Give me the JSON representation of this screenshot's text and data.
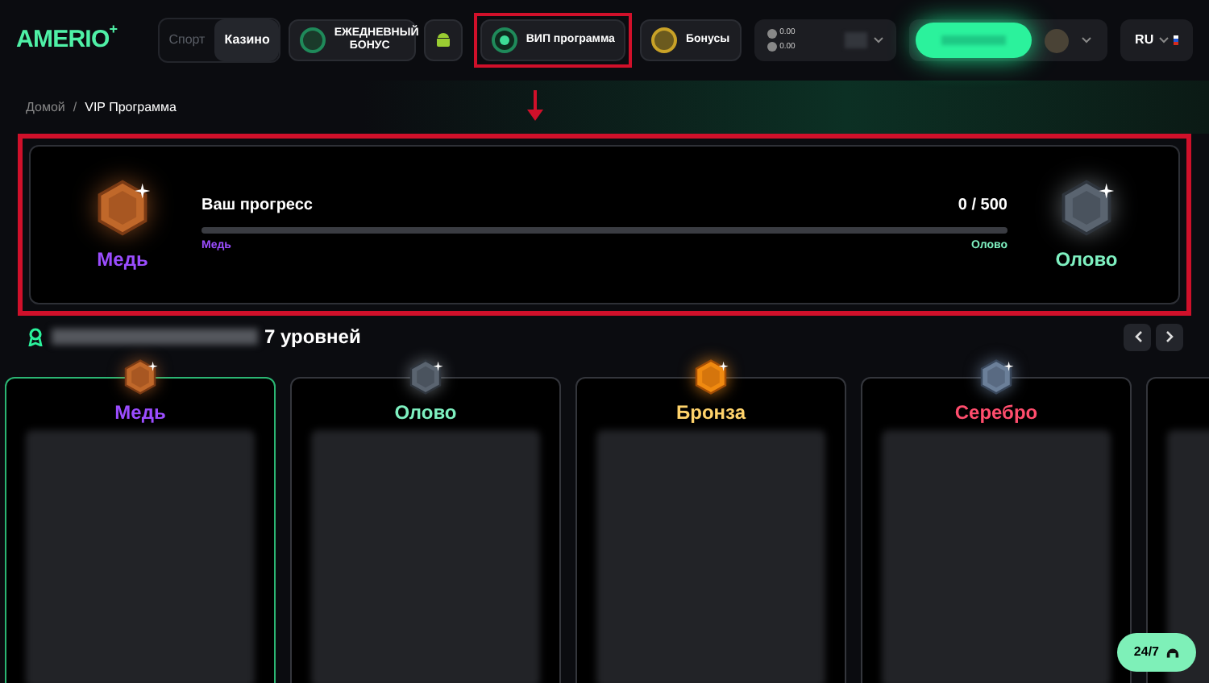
{
  "header": {
    "logo": "AMERIO",
    "logo_mark": "+",
    "nav": [
      {
        "kind": "segment",
        "items": [
          {
            "label": "Спорт",
            "selected": false
          },
          {
            "label": "Казино",
            "selected": true
          }
        ]
      },
      {
        "kind": "bonus",
        "label": "ЕЖЕДНЕВНЫЙ БОНУС",
        "highlighted": false
      },
      {
        "kind": "app",
        "highlighted": false
      },
      {
        "kind": "button",
        "label": "ВИП программа",
        "highlighted": true
      },
      {
        "kind": "button",
        "label": "Бонусы",
        "highlighted": false
      }
    ],
    "balance": [
      "0.00",
      "0.00"
    ],
    "language": "RU"
  },
  "breadcrumbs": [
    "Домой",
    "VIP Программа"
  ],
  "breadcrumb_separator": "/",
  "progress": {
    "current": {
      "name": "Медь",
      "color": "#9b4dff"
    },
    "next": {
      "name": "Олово",
      "color": "#7ef0c0"
    },
    "title": "Ваш прогресс",
    "value": "0 / 500",
    "level": 0,
    "highlighted": true,
    "start_label": {
      "name": "Медь",
      "color": "#9b4dff"
    },
    "end_label": {
      "name": "Олово",
      "color": "#7ef0c0"
    }
  },
  "levels_heading": "7 уровней",
  "levels": [
    {
      "name": "Медь",
      "color": "#9b4dff",
      "selected": true
    },
    {
      "name": "Олово",
      "color": "#7ef0c0",
      "selected": false
    },
    {
      "name": "Бронза",
      "color": "#ffd36b",
      "selected": false
    },
    {
      "name": "Серебро",
      "color": "#ff4d6d",
      "selected": false
    },
    {
      "selected": false
    }
  ],
  "support_label": "24/7"
}
